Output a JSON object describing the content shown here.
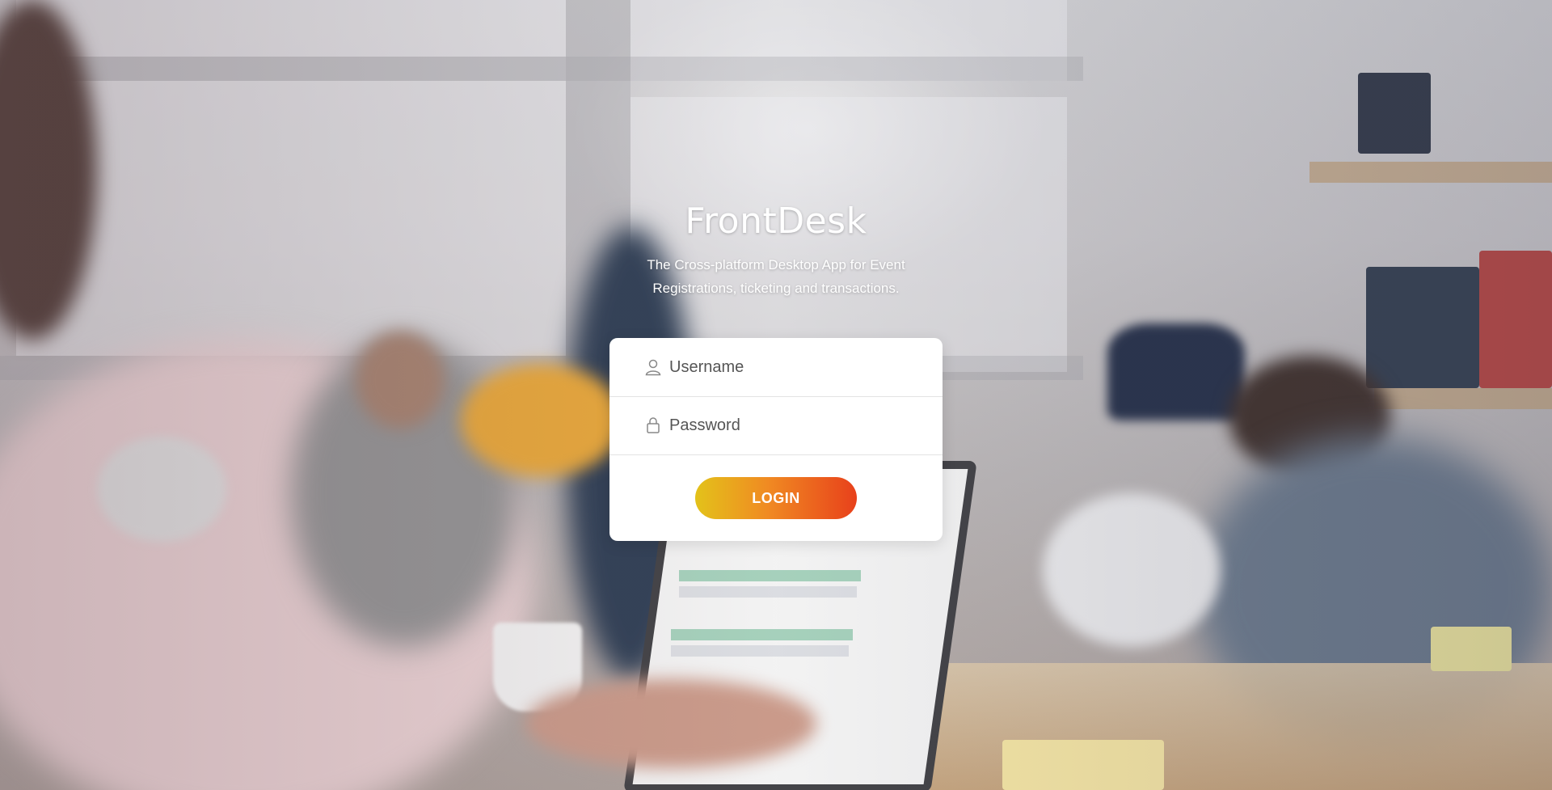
{
  "app": {
    "title": "FrontDesk",
    "subtitle": "The Cross-platform Desktop App for Event Registrations, ticketing and transactions."
  },
  "login": {
    "username_placeholder": "Username",
    "password_placeholder": "Password",
    "username_value": "",
    "password_value": "",
    "submit_label": "LOGIN",
    "username_icon": "user-icon",
    "password_icon": "lock-icon"
  },
  "colors": {
    "button_gradient_start": "#e3c21a",
    "button_gradient_mid": "#f08a22",
    "button_gradient_end": "#e8411b",
    "card_background": "#ffffff",
    "text_on_background": "#ffffff"
  }
}
